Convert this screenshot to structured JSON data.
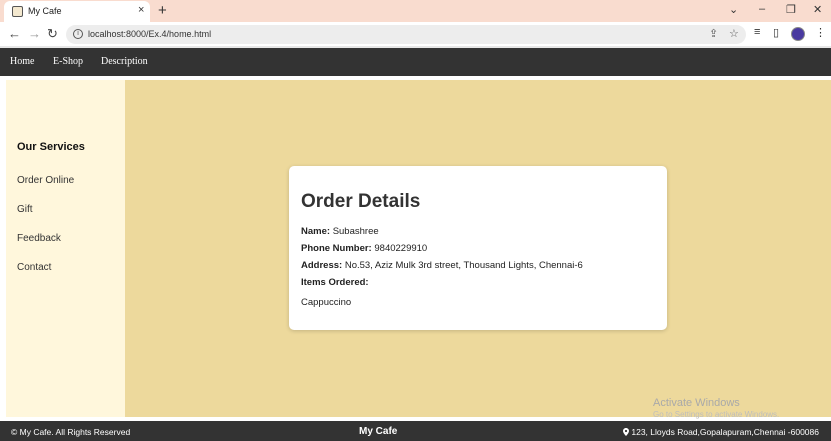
{
  "browser": {
    "tab_title": "My Cafe",
    "tab_close": "×",
    "new_tab": "+",
    "url": "localhost:8000/Ex.4/home.html",
    "back": "←",
    "forward": "→",
    "reload": "↻",
    "info": "i",
    "share": "⇪",
    "star": "☆",
    "queue": "≡",
    "sidebar_toggle": "▯",
    "menu": "⋮",
    "win_dropdown": "⌄",
    "win_minimize": "–",
    "win_restore": "❐",
    "win_close": "✕"
  },
  "nav": {
    "items": [
      "Home",
      "E-Shop",
      "Description"
    ]
  },
  "sidebar": {
    "heading": "Our Services",
    "links": [
      "Order Online",
      "Gift",
      "Feedback",
      "Contact"
    ]
  },
  "order": {
    "title": "Order Details",
    "name_label": "Name:",
    "name_value": "Subashree",
    "phone_label": "Phone Number:",
    "phone_value": "9840229910",
    "address_label": "Address:",
    "address_value": "No.53, Aziz Mulk 3rd street, Thousand Lights, Chennai-6",
    "items_label": "Items Ordered:",
    "items": [
      "Cappuccino"
    ]
  },
  "footer": {
    "copyright": "© My Cafe. All Rights Reserved",
    "brand": "My Cafe",
    "address": "123, Lloyds Road,Gopalapuram,Chennai -600086",
    "location_icon": "pin-icon"
  },
  "watermark": {
    "title": "Activate Windows",
    "subtitle": "Go to Settings to activate Windows."
  },
  "colors": {
    "navbar": "#333333",
    "sidebar": "#fff7dc",
    "main": "#edd99c",
    "tabstrip": "#f9dccf"
  }
}
